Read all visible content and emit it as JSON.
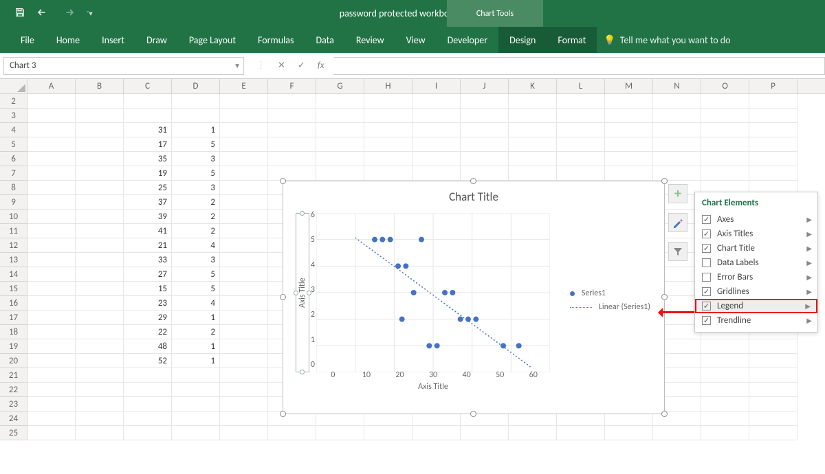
{
  "app": {
    "title": "password protected workbook  -  Excel",
    "context_tab": "Chart Tools"
  },
  "qat": {
    "save": "save-icon",
    "undo": "undo-icon",
    "redo": "redo-icon",
    "custom": "customize-icon"
  },
  "ribbon": {
    "tabs": [
      "File",
      "Home",
      "Insert",
      "Draw",
      "Page Layout",
      "Formulas",
      "Data",
      "Review",
      "View",
      "Developer",
      "Design",
      "Format"
    ],
    "context_tabs": [
      "Design",
      "Format"
    ],
    "tellme": "Tell me what you want to do"
  },
  "fxbar": {
    "name": "Chart 3",
    "fx": "fx",
    "value": ""
  },
  "columns": {
    "headers": [
      "A",
      "B",
      "C",
      "D",
      "E",
      "F",
      "G",
      "H",
      "I",
      "J",
      "K",
      "L",
      "M",
      "N",
      "O",
      "P"
    ],
    "widths": [
      70,
      70,
      70,
      70,
      70,
      70,
      70,
      70,
      70,
      70,
      70,
      70,
      70,
      70,
      70,
      70
    ]
  },
  "rows": {
    "start": 2,
    "end": 25
  },
  "cells": {
    "c_col": {
      "4": 31,
      "5": 17,
      "6": 35,
      "7": 19,
      "8": 25,
      "9": 37,
      "10": 39,
      "11": 41,
      "12": 21,
      "13": 33,
      "14": 27,
      "15": 15,
      "16": 23,
      "17": 29,
      "18": 22,
      "19": 48,
      "20": 52
    },
    "d_col": {
      "4": 1,
      "5": 5,
      "6": 3,
      "7": 5,
      "8": 3,
      "9": 2,
      "10": 2,
      "11": 2,
      "12": 4,
      "13": 3,
      "14": 5,
      "15": 5,
      "16": 4,
      "17": 1,
      "18": 2,
      "19": 1,
      "20": 1
    }
  },
  "chart_data": {
    "type": "scatter",
    "title": "Chart Title",
    "xlabel": "Axis Title",
    "ylabel": "Axis Title",
    "xlim": [
      0,
      60
    ],
    "ylim": [
      0,
      6
    ],
    "xticks": [
      0,
      10,
      20,
      30,
      40,
      50,
      60
    ],
    "yticks": [
      0,
      1,
      2,
      3,
      4,
      5,
      6
    ],
    "series": [
      {
        "name": "Series1",
        "x": [
          31,
          17,
          35,
          19,
          25,
          37,
          39,
          41,
          21,
          33,
          27,
          15,
          23,
          29,
          22,
          48,
          52
        ],
        "y": [
          1,
          5,
          3,
          5,
          3,
          2,
          2,
          2,
          4,
          3,
          5,
          5,
          4,
          1,
          2,
          1,
          1
        ]
      }
    ],
    "trendline": {
      "name": "Linear (Series1)"
    },
    "legend_entries": [
      "Series1",
      "Linear (Series1)"
    ]
  },
  "side_buttons": {
    "plus": "chart-elements",
    "brush": "chart-styles",
    "filter": "chart-filters"
  },
  "flyout": {
    "title": "Chart Elements",
    "items": [
      {
        "label": "Axes",
        "checked": true
      },
      {
        "label": "Axis Titles",
        "checked": true
      },
      {
        "label": "Chart Title",
        "checked": true
      },
      {
        "label": "Data Labels",
        "checked": false
      },
      {
        "label": "Error Bars",
        "checked": false
      },
      {
        "label": "Gridlines",
        "checked": true
      },
      {
        "label": "Legend",
        "checked": true,
        "highlight": true
      },
      {
        "label": "Trendline",
        "checked": true
      }
    ]
  }
}
